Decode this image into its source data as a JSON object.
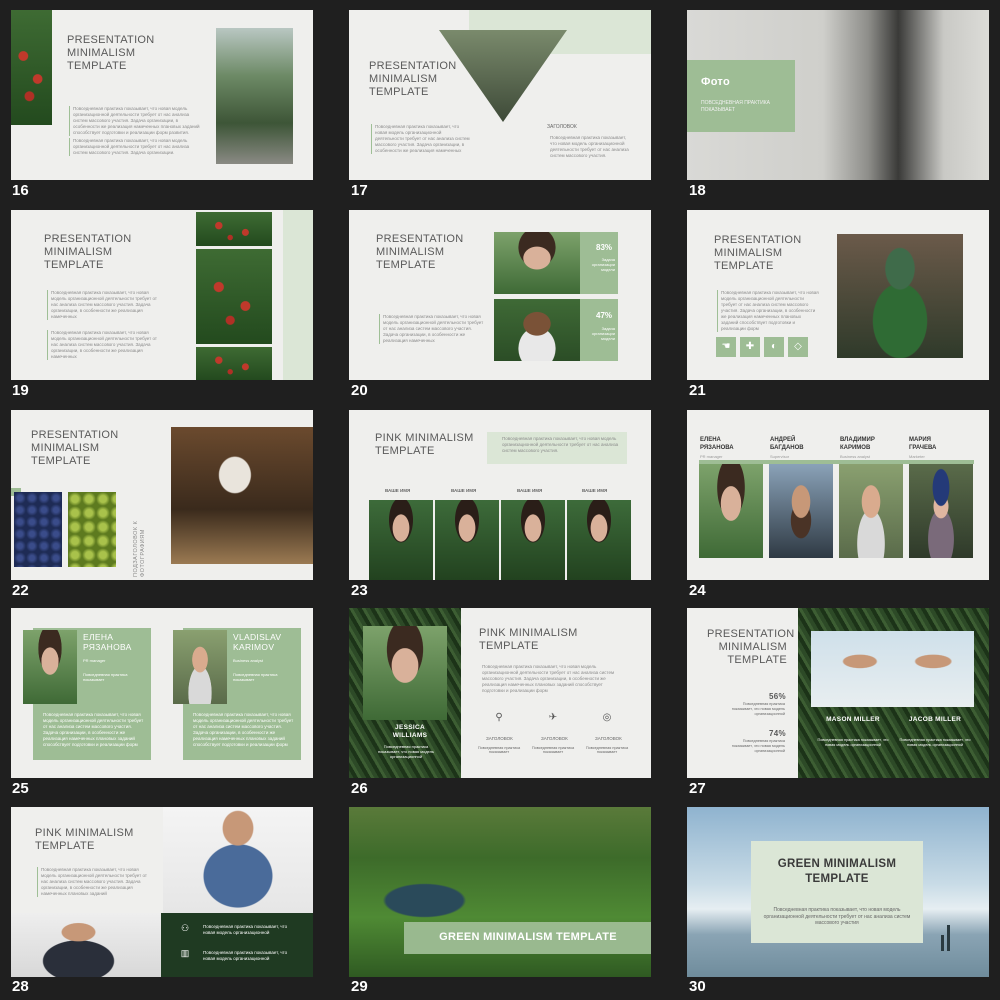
{
  "slides": [
    {
      "n": "16",
      "title": "PRESENTATION MINIMALISM TEMPLATE",
      "text1": "Повседневная практика показывает, что новая модель организационной деятельности требует от нас анализа систем массового участия. Задача организации, в особенности же реализация намеченных плановых заданий способствует подготовки и реализации форм развития.",
      "text2": "Повседневная практика показывает, что новая модель организационной деятельности требует от нас анализа систем массового участия. Задача организации."
    },
    {
      "n": "17",
      "title": "PRESENTATION MINIMALISM TEMPLATE",
      "text1": "Повседневная практика показывает, что новая модель организационной деятельности требует от нас анализа систем массового участия. Задача организации, в особенности же реализация намеченных",
      "heading": "ЗАГОЛОВОК",
      "text2": "Повседневная практика показывает, что новая модель организационной деятельности требует от нас анализа систем массового участия."
    },
    {
      "n": "18",
      "title": "Фото",
      "subtitle": "ПОВСЕДНЕВНАЯ ПРАКТИКА ПОКАЗЫВАЕТ"
    },
    {
      "n": "19",
      "title": "PRESENTATION MINIMALISM TEMPLATE",
      "text1": "Повседневная практика показывает, что новая модель организационной деятельности требует от нас анализа систем массового участия. Задача организации, в особенности же реализация намеченных",
      "text2": "Повседневная практика показывает, что новая модель организационной деятельности требует от нас анализа систем массового участия. Задача организации, в особенности же реализация намеченных"
    },
    {
      "n": "20",
      "title": "PRESENTATION MINIMALISM TEMPLATE",
      "text1": "Повседневная практика показывает, что новая модель организационной деятельности требует от нас анализа систем массового участия. Задача организации, в особенности же реализация намеченных",
      "stat1": "83%",
      "stat1_text": "Задача организации модели",
      "stat2": "47%",
      "stat2_text": "Задача организации модели"
    },
    {
      "n": "21",
      "title": "PRESENTATION MINIMALISM TEMPLATE",
      "text1": "Повседневная практика показывает, что новая модель организационной деятельности требует от нас анализа систем массового участия. Задача организации, в особенности же реализация намеченных плановых заданий способствует подготовки и реализации форм"
    },
    {
      "n": "22",
      "title": "PRESENTATION MINIMALISM TEMPLATE",
      "vertical": "ПОДЗАГОЛОВОК К ФОТОГРАФИЯМ"
    },
    {
      "n": "23",
      "title": "PINK MINIMALISM TEMPLATE",
      "text1": "Повседневная практика показывает, что новая модель организационной деятельности требует от нас анализа систем массового участия.",
      "names": [
        "ВАШЕ ИМЯ",
        "ВАШЕ ИМЯ",
        "ВАШЕ ИМЯ",
        "ВАШЕ ИМЯ"
      ]
    },
    {
      "n": "24",
      "people": [
        {
          "name": "ЕЛЕНА РЯЗАНОВА",
          "role": "PR manager"
        },
        {
          "name": "АНДРЕЙ БАГДАНОВ",
          "role": "Supervisor"
        },
        {
          "name": "ВЛАДИМИР КАРИМОВ",
          "role": "Business analyst"
        },
        {
          "name": "МАРИЯ ГРАЧЕВА",
          "role": "Marketer"
        }
      ]
    },
    {
      "n": "25",
      "p1_name": "ЕЛЕНА РЯЗАНОВА",
      "p1_role": "PR manager",
      "p1_short": "Повседневная практика показывает",
      "p2_name": "VLADISLAV KARIMOV",
      "p2_role": "Business analyst",
      "p2_short": "Повседневная практика показывает",
      "text1": "Повседневная практика показывает, что новая модель организационной деятельности требует от нас анализа систем массового участия. Задача организации, в особенности же реализация намеченных плановых заданий способствует подготовки и реализации форм",
      "text2": "Повседневная практика показывает, что новая модель организационной деятельности требует от нас анализа систем массового участия. Задача организации, в особенности же реализация намеченных плановых заданий способствует подготовки и реализации форм"
    },
    {
      "n": "26",
      "title": "PINK MINIMALISM TEMPLATE",
      "text1": "Повседневная практика показывает, что новая модель организационной деятельности требует от нас анализа систем массового участия. Задача организации, в особенности же реализация намеченных плановых заданий способствует подготовки и реализации форм",
      "name": "JESSICA WILLIAMS",
      "name_text": "Повседневная практика показывает, что новая модель организационной",
      "icons": [
        {
          "label": "ЗАГОЛОВОК",
          "text": "Повседневная практика показывает"
        },
        {
          "label": "ЗАГОЛОВОК",
          "text": "Повседневная практика показывает"
        },
        {
          "label": "ЗАГОЛОВОК",
          "text": "Повседневная практика показывает"
        }
      ]
    },
    {
      "n": "27",
      "title": "PRESENTATION MINIMALISM TEMPLATE",
      "stat1": "56%",
      "stat1_text": "Повседневная практика показывает, что новая модель организационной",
      "stat2": "74%",
      "stat2_text": "Повседневная практика показывает, что новая модель организационной",
      "p1": "MASON MILLER",
      "p1_text": "Повседневная практика показывает, что новая модель организационной",
      "p2": "JACOB MILLER",
      "p2_text": "Повседневная практика показывает, что новая модель организационной"
    },
    {
      "n": "28",
      "title": "PINK MINIMALISM TEMPLATE",
      "text1": "Повседневная практика показывает, что новая модель организационной деятельности требует от нас анализа систем массового участия. Задача организации, в особенности же реализация намеченных плановых заданий",
      "item1": "Повседневная практика показывает, что новая модель организационной",
      "item2": "Повседневная практика показывает, что новая модель организационной"
    },
    {
      "n": "29",
      "title": "GREEN MINIMALISM TEMPLATE"
    },
    {
      "n": "30",
      "title": "GREEN MINIMALISM TEMPLATE",
      "text1": "Повседневная практика показывает, что новая модель организационной деятельности требует от нас анализа систем массового участия"
    }
  ]
}
